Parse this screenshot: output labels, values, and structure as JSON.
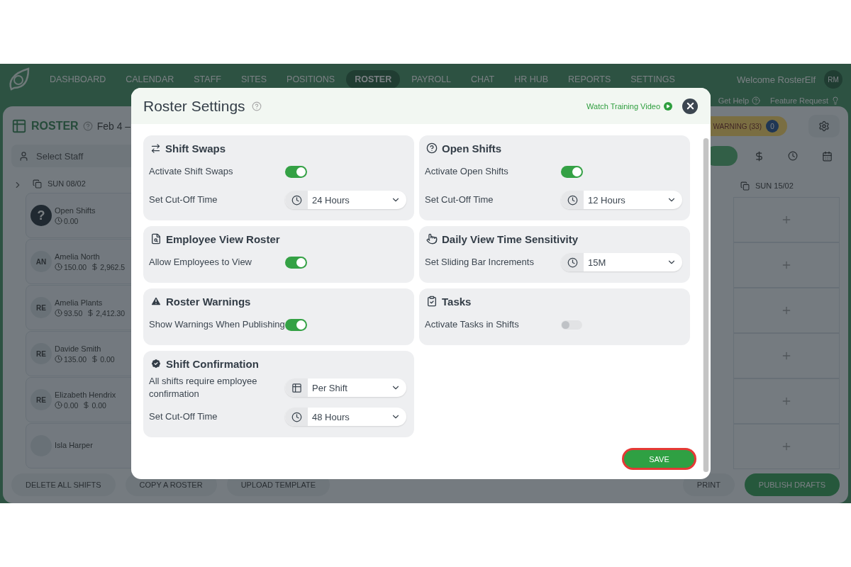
{
  "nav": {
    "items": [
      {
        "label": "DASHBOARD",
        "selected": false
      },
      {
        "label": "CALENDAR",
        "selected": false
      },
      {
        "label": "STAFF",
        "selected": false
      },
      {
        "label": "SITES",
        "selected": false
      },
      {
        "label": "POSITIONS",
        "selected": false
      },
      {
        "label": "ROSTER",
        "selected": true
      },
      {
        "label": "PAYROLL",
        "selected": false
      },
      {
        "label": "CHAT",
        "selected": false
      },
      {
        "label": "HR HUB",
        "selected": false
      },
      {
        "label": "REPORTS",
        "selected": false
      },
      {
        "label": "SETTINGS",
        "selected": false
      }
    ],
    "welcome": "Welcome RosterElf",
    "avatar": "RM"
  },
  "help_links": [
    "Get Help",
    "Feature Request"
  ],
  "roster": {
    "title": "ROSTER",
    "date_range": "Feb 4 –",
    "warning": "WARNING (33)",
    "warning_count": "0",
    "staff_placeholder": "Select Staff"
  },
  "days": [
    "SUN 08/02",
    "SUN 15/02"
  ],
  "staff": [
    {
      "name": "Open Shifts",
      "avatar": "?",
      "hours": "0.00"
    },
    {
      "name": "Amelia North",
      "avatar": "AN",
      "hours": "150.00",
      "cost": "2,962.5"
    },
    {
      "name": "Amelia Plants",
      "avatar": "RE",
      "hours": "93.50",
      "cost": "2,412.30"
    },
    {
      "name": "Davide Smith",
      "avatar": "RE",
      "hours": "135.00",
      "cost": "0.00"
    },
    {
      "name": "Elizabeth Hendrix",
      "avatar": "RE",
      "hours": "0.00",
      "cost": "0.00"
    },
    {
      "name": "Isla Harper"
    }
  ],
  "actions": [
    "DELETE ALL SHIFTS",
    "COPY A ROSTER",
    "UPLOAD TEMPLATE"
  ],
  "actions_right": [
    {
      "label": "PRINT",
      "kind": "plain"
    },
    {
      "label": "PUBLISH DRAFTS",
      "kind": "primary"
    }
  ],
  "modal": {
    "title": "Roster Settings",
    "training_link": "Watch Training Video",
    "save": "SAVE",
    "sections": [
      {
        "title": "Shift Swaps",
        "rows": [
          {
            "kind": "toggle",
            "label": "Activate Shift Swaps",
            "on": true
          },
          {
            "kind": "time-select",
            "label": "Set Cut-Off Time",
            "value": "24 Hours"
          }
        ]
      },
      {
        "title": "Open Shifts",
        "rows": [
          {
            "kind": "toggle",
            "label": "Activate Open Shifts",
            "on": true
          },
          {
            "kind": "time-select",
            "label": "Set Cut-Off Time",
            "value": "12 Hours"
          }
        ]
      },
      {
        "title": "Employee View Roster",
        "rows": [
          {
            "kind": "toggle",
            "label": "Allow Employees to View",
            "on": true
          }
        ]
      },
      {
        "title": "Daily View Time Sensitivity",
        "rows": [
          {
            "kind": "time-select",
            "label": "Set Sliding Bar Increments",
            "value": "15M"
          }
        ]
      },
      {
        "title": "Roster Warnings",
        "rows": [
          {
            "kind": "toggle",
            "label": "Show Warnings When Publishing",
            "on": true
          }
        ]
      },
      {
        "title": "Tasks",
        "rows": [
          {
            "kind": "toggle",
            "label": "Activate Tasks in Shifts",
            "on": false
          }
        ]
      },
      {
        "title": "Shift Confirmation",
        "rows": [
          {
            "kind": "mode-select",
            "label": "All shifts require employee confirmation",
            "value": "Per Shift"
          },
          {
            "kind": "time-select",
            "label": "Set Cut-Off Time",
            "value": "48 Hours"
          }
        ]
      }
    ]
  }
}
